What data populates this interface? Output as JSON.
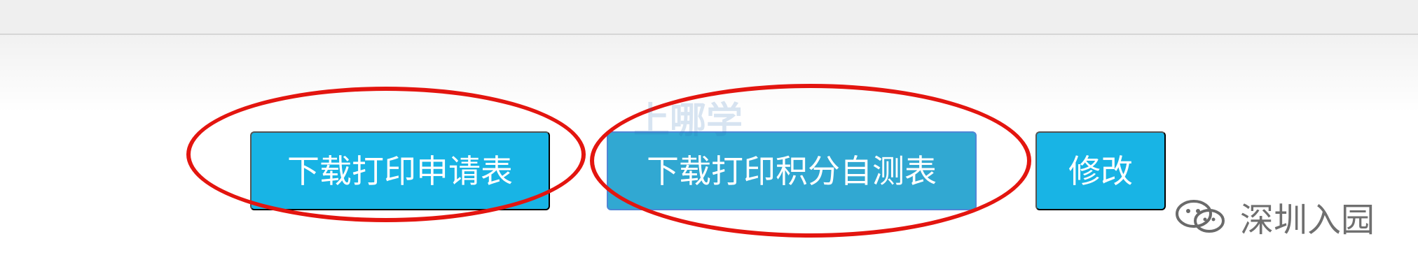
{
  "buttons": {
    "apply_form": "下载打印申请表",
    "self_test_form": "下载打印积分自测表",
    "edit": "修改"
  },
  "watermark": {
    "text": "深圳入园",
    "stamp_text": "上哪学"
  },
  "colors": {
    "button_bg": "#18b4e5",
    "button_bg_active": "#31a8d2",
    "annotation_red": "#e3150f",
    "top_bar": "#efefef"
  }
}
